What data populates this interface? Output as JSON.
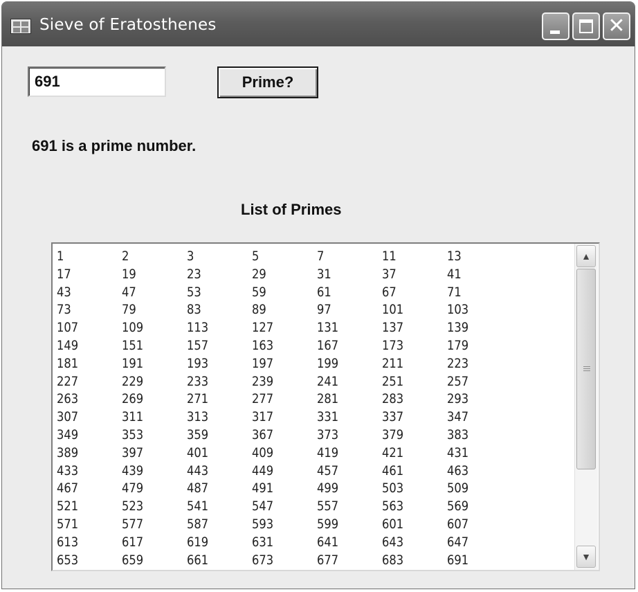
{
  "window": {
    "title": "Sieve of Eratosthenes",
    "controls": {
      "minimize": "minimize",
      "maximize": "maximize",
      "close": "close"
    }
  },
  "input": {
    "value": "691"
  },
  "button": {
    "label": "Prime?"
  },
  "result": {
    "text": "691 is a prime number."
  },
  "list": {
    "title": "List of Primes",
    "rows": [
      [
        "1",
        "2",
        "3",
        "5",
        "7",
        "11",
        "13"
      ],
      [
        "17",
        "19",
        "23",
        "29",
        "31",
        "37",
        "41"
      ],
      [
        "43",
        "47",
        "53",
        "59",
        "61",
        "67",
        "71"
      ],
      [
        "73",
        "79",
        "83",
        "89",
        "97",
        "101",
        "103"
      ],
      [
        "107",
        "109",
        "113",
        "127",
        "131",
        "137",
        "139"
      ],
      [
        "149",
        "151",
        "157",
        "163",
        "167",
        "173",
        "179"
      ],
      [
        "181",
        "191",
        "193",
        "197",
        "199",
        "211",
        "223"
      ],
      [
        "227",
        "229",
        "233",
        "239",
        "241",
        "251",
        "257"
      ],
      [
        "263",
        "269",
        "271",
        "277",
        "281",
        "283",
        "293"
      ],
      [
        "307",
        "311",
        "313",
        "317",
        "331",
        "337",
        "347"
      ],
      [
        "349",
        "353",
        "359",
        "367",
        "373",
        "379",
        "383"
      ],
      [
        "389",
        "397",
        "401",
        "409",
        "419",
        "421",
        "431"
      ],
      [
        "433",
        "439",
        "443",
        "449",
        "457",
        "461",
        "463"
      ],
      [
        "467",
        "479",
        "487",
        "491",
        "499",
        "503",
        "509"
      ],
      [
        "521",
        "523",
        "541",
        "547",
        "557",
        "563",
        "569"
      ],
      [
        "571",
        "577",
        "587",
        "593",
        "599",
        "601",
        "607"
      ],
      [
        "613",
        "617",
        "619",
        "631",
        "641",
        "643",
        "647"
      ],
      [
        "653",
        "659",
        "661",
        "673",
        "677",
        "683",
        "691"
      ]
    ]
  },
  "scrollbar": {
    "up_icon": "chevron-up-icon",
    "down_icon": "chevron-down-icon"
  }
}
